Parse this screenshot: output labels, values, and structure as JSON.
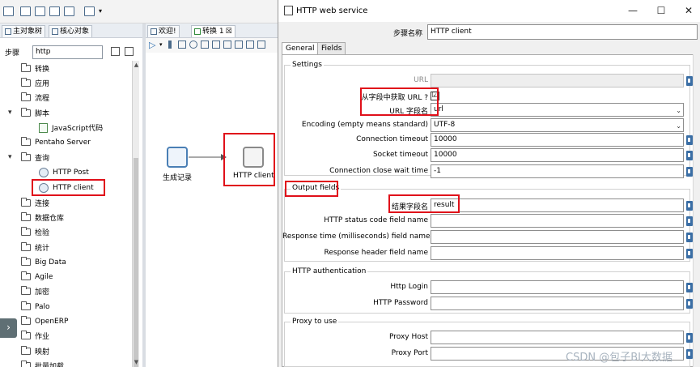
{
  "left": {
    "tabs": [
      {
        "label": "主对象树"
      },
      {
        "label": "核心对象"
      }
    ],
    "search": {
      "label": "步骤",
      "value": "http"
    },
    "tree": [
      {
        "label": "转换",
        "type": "folder"
      },
      {
        "label": "应用",
        "type": "folder"
      },
      {
        "label": "流程",
        "type": "folder"
      },
      {
        "label": "脚本",
        "type": "folder",
        "expanded": true
      },
      {
        "label": "JavaScript代码",
        "type": "step"
      },
      {
        "label": "Pentaho Server",
        "type": "folder"
      },
      {
        "label": "查询",
        "type": "folder",
        "expanded": true
      },
      {
        "label": "HTTP Post",
        "type": "step"
      },
      {
        "label": "HTTP client",
        "type": "step",
        "highlighted": true
      },
      {
        "label": "连接",
        "type": "folder"
      },
      {
        "label": "数据仓库",
        "type": "folder"
      },
      {
        "label": "检验",
        "type": "folder"
      },
      {
        "label": "统计",
        "type": "folder"
      },
      {
        "label": "Big Data",
        "type": "folder"
      },
      {
        "label": "Agile",
        "type": "folder"
      },
      {
        "label": "加密",
        "type": "folder"
      },
      {
        "label": "Palo",
        "type": "folder"
      },
      {
        "label": "OpenERP",
        "type": "folder"
      },
      {
        "label": "作业",
        "type": "folder"
      },
      {
        "label": "映射",
        "type": "folder"
      },
      {
        "label": "批量加载",
        "type": "folder"
      }
    ],
    "expand_button": "›"
  },
  "canvas": {
    "tabs": [
      {
        "label": "欢迎!"
      },
      {
        "label": "转换 1"
      }
    ],
    "tab_close": "☒",
    "steps": [
      {
        "label": "生成记录"
      },
      {
        "label": "HTTP client"
      }
    ]
  },
  "dialog": {
    "title": "HTTP web service",
    "controls": {
      "minimize": "—",
      "maximize": "☐",
      "close": "✕"
    },
    "step_name_label": "步骤名称",
    "step_name_value": "HTTP client",
    "tabs": [
      {
        "label": "General"
      },
      {
        "label": "Fields"
      }
    ],
    "settings": {
      "title": "Settings",
      "url_label": "URL",
      "url_from_field_label": "从字段中获取 URL ?",
      "url_from_field_checked": "☑",
      "url_field_label": "URL 字段名",
      "url_field_value": "url",
      "encoding_label": "Encoding (empty means standard)",
      "encoding_value": "UTF-8",
      "conn_timeout_label": "Connection timeout",
      "conn_timeout_value": "10000",
      "socket_timeout_label": "Socket timeout",
      "socket_timeout_value": "10000",
      "close_wait_label": "Connection close wait time",
      "close_wait_value": "-1"
    },
    "output": {
      "title": "Output fields",
      "result_label": "结果字段名",
      "result_value": "result",
      "status_code_label": "HTTP status code field name",
      "response_time_label": "Response time (milliseconds) field name",
      "response_header_label": "Response header field name"
    },
    "auth": {
      "title": "HTTP authentication",
      "login_label": "Http Login",
      "password_label": "HTTP Password"
    },
    "proxy": {
      "title": "Proxy to use",
      "host_label": "Proxy Host",
      "port_label": "Proxy Port"
    }
  },
  "watermark": "CSDN @包子BI大数据",
  "colors": {
    "highlight": "#e0101a",
    "step_border": "#4a7fb5",
    "variable_icon": "#3a6ea5"
  }
}
